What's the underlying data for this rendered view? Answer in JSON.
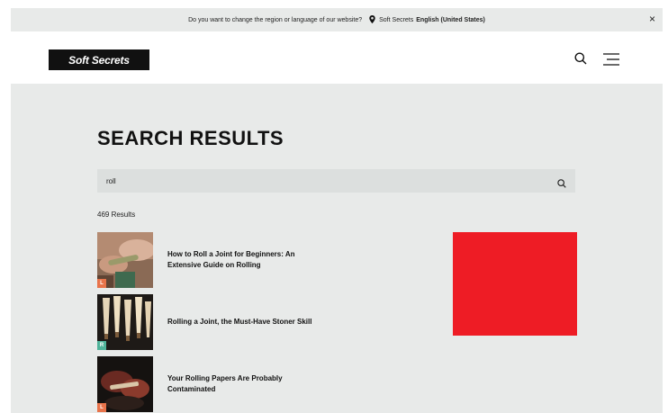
{
  "banner": {
    "question": "Do you want to change the region or language of our website?",
    "brand": "Soft Secrets",
    "region": "English (United States)",
    "close": "×"
  },
  "header": {
    "logo": "Soft Secrets"
  },
  "page": {
    "title": "SEARCH RESULTS"
  },
  "search": {
    "value": "roll"
  },
  "results_count": "469 Results",
  "results": [
    {
      "title": "How to Roll a Joint for Beginners: An Extensive Guide on Rolling",
      "badge": "L",
      "badge_color": "#e8734a"
    },
    {
      "title": "Rolling a Joint, the Must-Have Stoner Skill",
      "badge": "R",
      "badge_color": "#4fb39a"
    },
    {
      "title": "Your Rolling Papers Are Probably Contaminated",
      "badge": "L",
      "badge_color": "#e8734a"
    }
  ],
  "ad": {
    "color": "#ee1c25"
  }
}
